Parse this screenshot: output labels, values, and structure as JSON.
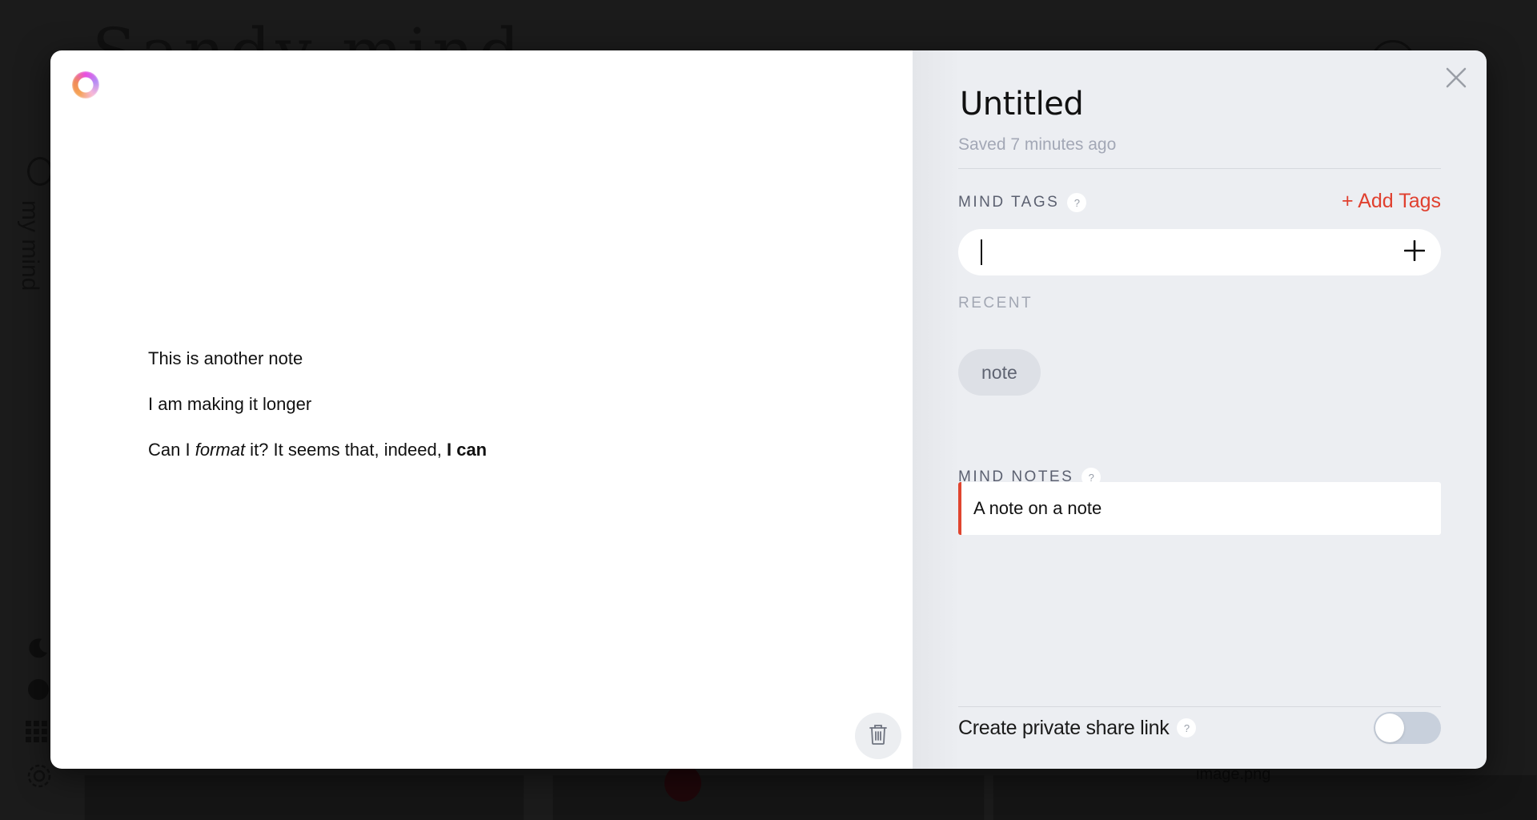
{
  "background_app": {
    "title": "Sandy mind",
    "sidebar_label": "my mind",
    "caption": "image.png",
    "sidebar_icons": [
      "moon-icon",
      "brain-icon",
      "grid-icon",
      "gear-icon"
    ]
  },
  "editor": {
    "logo": "gradient-ring-logo",
    "lines": [
      {
        "text": "This is another note"
      },
      {
        "text": "I am making it longer"
      },
      {
        "segments": [
          {
            "text": "Can I ",
            "style": "normal"
          },
          {
            "text": "format",
            "style": "italic"
          },
          {
            "text": " it? It seems that, indeed, ",
            "style": "normal"
          },
          {
            "text": "I can",
            "style": "bold"
          }
        ]
      }
    ],
    "delete_button_icon": "trash-icon"
  },
  "meta": {
    "title": "Untitled",
    "saved_status": "Saved 7 minutes ago",
    "close_icon": "close-icon",
    "mind_tags": {
      "label": "MIND TAGS",
      "help": "?",
      "add_tags_label": "+ Add Tags",
      "input_value": "",
      "input_placeholder": "",
      "add_icon": "plus-icon"
    },
    "recent": {
      "label": "RECENT",
      "tags": [
        "note"
      ]
    },
    "mind_notes": {
      "label": "MIND NOTES",
      "help": "?",
      "items": [
        "A note on a note"
      ]
    },
    "share": {
      "label": "Create private share link",
      "help": "?",
      "enabled": false
    }
  },
  "colors": {
    "accent": "#e0402f",
    "panel_bg": "#eceef2",
    "chip_bg": "#dde0e6",
    "toggle_off": "#c8d0dc",
    "muted_text": "#a3a8b6"
  }
}
